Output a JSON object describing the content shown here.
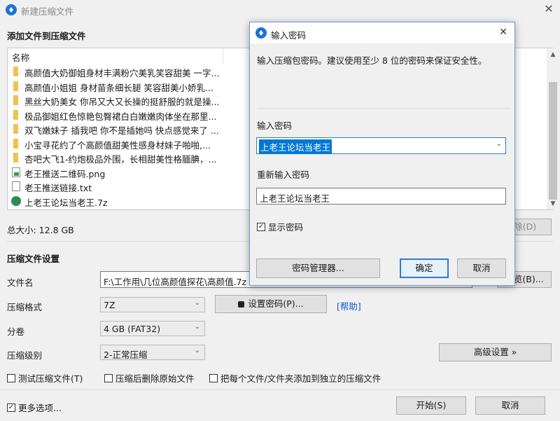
{
  "window": {
    "title": "新建压缩文件",
    "close_glyph": "✕"
  },
  "add_section": {
    "heading": "添加文件到压缩文件",
    "column_header": "名称",
    "files": [
      {
        "name": "高颜值大奶御姐身材丰满粉穴美乳笑容甜美 一字...",
        "icon": "folder-icon"
      },
      {
        "name": "高颜值小姐姐 身材苗条细长腿 笑容甜美小娇乳...",
        "icon": "folder-icon"
      },
      {
        "name": "黑丝大奶美女 你吊又大又长操的挺舒服的就是操...",
        "icon": "folder-icon"
      },
      {
        "name": "极品御姐红色惊艳包臀裙白白嫩嫩肉体坐在那里...",
        "icon": "folder-icon"
      },
      {
        "name": "双飞嫩妹子 插我吧 你不是插她吗 快点感觉来了 ...",
        "icon": "folder-icon"
      },
      {
        "name": "小宝寻花约了个高颜值甜美性感身材妹子啪啪,...",
        "icon": "folder-icon"
      },
      {
        "name": "杏吧大飞1-约炮极品外围，长相甜美性格腼腆，...",
        "icon": "folder-icon"
      },
      {
        "name": "老王推送二维码.png",
        "icon": "image-file-icon"
      },
      {
        "name": "老王推送链接.txt",
        "icon": "text-file-icon"
      },
      {
        "name": "上老王论坛当老王.7z",
        "icon": "archive-file-icon"
      }
    ],
    "total_size": "总大小: 12.8 GB",
    "delete_button": "删除(D)"
  },
  "settings": {
    "heading": "压缩文件设置",
    "filename_label": "文件名",
    "filename_value": "F:\\工作用\\几位高颜值探花\\高颜值.7z",
    "browse_button": "浏览(B)...",
    "format_label": "压缩格式",
    "format_value": "7Z",
    "set_password_button": "设置密码(P)...",
    "help_link": "[帮助]",
    "volume_label": "分卷",
    "volume_value": "4 GB (FAT32)",
    "level_label": "压缩级别",
    "level_value": "2-正常压缩",
    "advanced_button": "高级设置 »",
    "options": [
      {
        "label": "测试压缩文件(T)",
        "checked": false
      },
      {
        "label": "压缩后删除原始文件",
        "checked": false
      },
      {
        "label": "把每个文件/文件夹添加到独立的压缩文件",
        "checked": false
      }
    ],
    "more_options": {
      "label": "更多选项...",
      "checked": true
    },
    "start_button": "开始(S)",
    "cancel_button": "取消"
  },
  "password_dialog": {
    "title": "输入密码",
    "close_glyph": "✕",
    "description": "输入压缩包密码。建议使用至少 8 位的密码来保证安全性。",
    "password_label": "输入密码",
    "password_value": "上老王论坛当老王",
    "confirm_label": "重新输入密码",
    "confirm_value": "上老王论坛当老王",
    "show_password": {
      "label": "显示密码",
      "checked": true
    },
    "manager_button": "密码管理器...",
    "ok_button": "确定",
    "cancel_button": "取消"
  },
  "colors": {
    "accent": "#2f7ad6",
    "link": "#0b57d0",
    "folder": "#f2c14e",
    "selection": "#0078d7"
  }
}
